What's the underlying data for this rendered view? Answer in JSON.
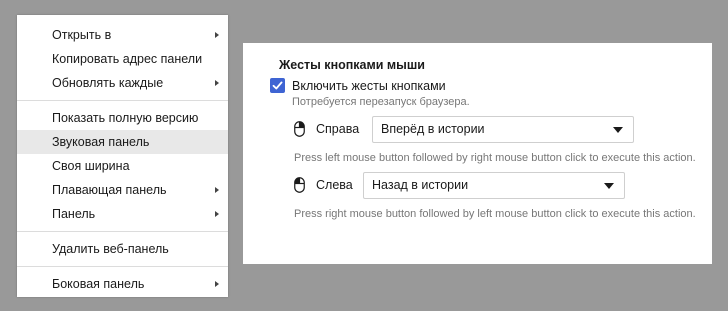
{
  "context_menu": {
    "items": [
      {
        "label": "Открыть в",
        "submenu": true
      },
      {
        "label": "Копировать адрес панели",
        "submenu": false
      },
      {
        "label": "Обновлять каждые",
        "submenu": true
      },
      {
        "label": "Показать полную версию",
        "submenu": false
      },
      {
        "label": "Звуковая панель",
        "submenu": false,
        "hovered": true
      },
      {
        "label": "Своя ширина",
        "submenu": false
      },
      {
        "label": "Плавающая панель",
        "submenu": true
      },
      {
        "label": "Панель",
        "submenu": true
      },
      {
        "label": "Удалить веб-панель",
        "submenu": false
      },
      {
        "label": "Боковая панель",
        "submenu": true
      }
    ]
  },
  "settings": {
    "title": "Жесты кнопками мыши",
    "enable_checkbox": {
      "label": "Включить жесты кнопками",
      "checked": true
    },
    "restart_hint": "Потребуется перезапуск браузера.",
    "right_gesture": {
      "label": "Справа",
      "icon": "mouse-right-icon",
      "selected": "Вперёд в истории",
      "description": "Press left mouse button followed by right mouse button click to execute this action."
    },
    "left_gesture": {
      "label": "Слева",
      "icon": "mouse-left-icon",
      "selected": "Назад в истории",
      "description": "Press right mouse button followed by left mouse button click to execute this action."
    }
  },
  "colors": {
    "background": "#999999",
    "accent": "#3e64d3",
    "hover": "#e8e8e8"
  }
}
